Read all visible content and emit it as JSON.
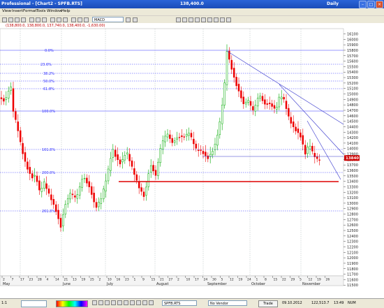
{
  "window": {
    "title": "Professional - [Chart2 - SPFB.RTS]",
    "center_title": "138,400.0",
    "timeframe": "Daily"
  },
  "menu": [
    "View",
    "Insert",
    "Format",
    "Tools",
    "Window",
    "Help"
  ],
  "toolbar": {
    "indicator": "MACD"
  },
  "ohlc_line": "(138,800.0, 138,800.0, 137,740.0, 138,400.0, -1,630.00)",
  "price_labels": [
    "16100",
    "16000",
    "15900",
    "15800",
    "15700",
    "15600",
    "15500",
    "15400",
    "15300",
    "15200",
    "15100",
    "15000",
    "14900",
    "14800",
    "14700",
    "14600",
    "14500",
    "14400",
    "14300",
    "14200",
    "14100",
    "14000",
    "13900",
    "13800",
    "13700",
    "13600",
    "13500",
    "13400",
    "13300",
    "13200",
    "13100",
    "13000",
    "12900",
    "12800",
    "12700",
    "12600",
    "12500",
    "12400",
    "12300",
    "12200",
    "12100",
    "12000",
    "11900",
    "11800",
    "11700",
    "11600",
    "11500"
  ],
  "current_price": "13840",
  "fib_levels": [
    "0.0%",
    "23.6%",
    "38.2%",
    "50.0%",
    "61.8%",
    "100.0%",
    "161.8%",
    "200.0%",
    "261.8%"
  ],
  "day_labels": [
    "2",
    "7",
    "17",
    "23",
    "28",
    "4",
    "14",
    "21",
    "13",
    "19",
    "25",
    "2",
    "10",
    "16",
    "23",
    "1",
    "9",
    "15",
    "21",
    "27",
    "2",
    "10",
    "17",
    "24",
    "30",
    "5",
    "12",
    "19",
    "24",
    "1",
    "8",
    "15",
    "22",
    "29",
    "5",
    "12",
    "19",
    "26"
  ],
  "month_labels": [
    "May",
    "June",
    "July",
    "August",
    "September",
    "October",
    "November"
  ],
  "status": {
    "symbol": "SPFB.RTS",
    "vendor": "No Vendor",
    "trade": "Trade",
    "date": "09.10.2012",
    "value": "122,513.7",
    "time": "13:49",
    "zoom": "1:1",
    "mode": "NUM"
  },
  "colors": {
    "bull": "#00aa00",
    "bear": "#ee0000",
    "fib": "#3333ff",
    "support": "#dd0000",
    "trend": "#3333cc"
  }
}
